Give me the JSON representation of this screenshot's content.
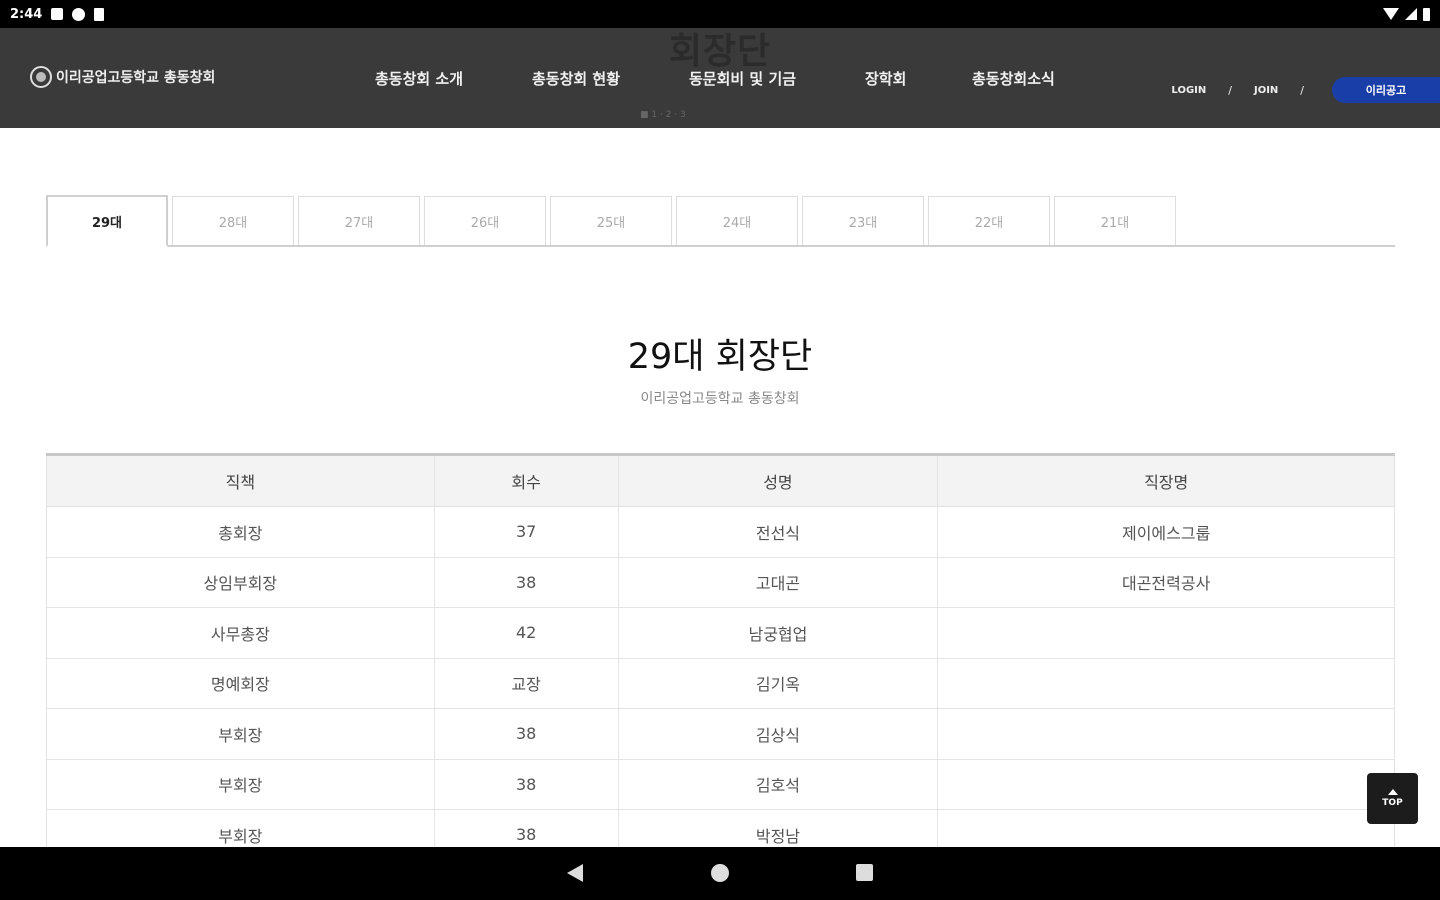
{
  "status_bar": {
    "time": "2:44"
  },
  "header": {
    "ghost_title": "회장단",
    "logo_text": "이리공업고등학교 총동창회",
    "nav": [
      {
        "label": "총동창회 소개"
      },
      {
        "label": "총동창회 현황"
      },
      {
        "label": "동문회비 및 기금"
      },
      {
        "label": "장학회"
      },
      {
        "label": "총동창회소식"
      }
    ],
    "sub_hint": "■ 1 · 2 · 3",
    "login_label": "LOGIN",
    "join_label": "JOIN",
    "separator": "/",
    "school_button_label": "이리공고"
  },
  "tabs": [
    {
      "label": "29대",
      "active": true
    },
    {
      "label": "28대",
      "active": false
    },
    {
      "label": "27대",
      "active": false
    },
    {
      "label": "26대",
      "active": false
    },
    {
      "label": "25대",
      "active": false
    },
    {
      "label": "24대",
      "active": false
    },
    {
      "label": "23대",
      "active": false
    },
    {
      "label": "22대",
      "active": false
    },
    {
      "label": "21대",
      "active": false
    }
  ],
  "main": {
    "title": "29대 회장단",
    "subtitle": "이리공업고등학교 총동창회"
  },
  "table": {
    "columns": [
      "직책",
      "회수",
      "성명",
      "직장명"
    ],
    "rows": [
      [
        "총회장",
        "37",
        "전선식",
        "제이에스그룹"
      ],
      [
        "상임부회장",
        "38",
        "고대곤",
        "대곤전력공사"
      ],
      [
        "사무총장",
        "42",
        "남궁협업",
        ""
      ],
      [
        "명예회장",
        "교장",
        "김기옥",
        ""
      ],
      [
        "부회장",
        "38",
        "김상식",
        ""
      ],
      [
        "부회장",
        "38",
        "김호석",
        ""
      ],
      [
        "부회장",
        "38",
        "박정남",
        ""
      ]
    ]
  },
  "top_button_label": "TOP"
}
